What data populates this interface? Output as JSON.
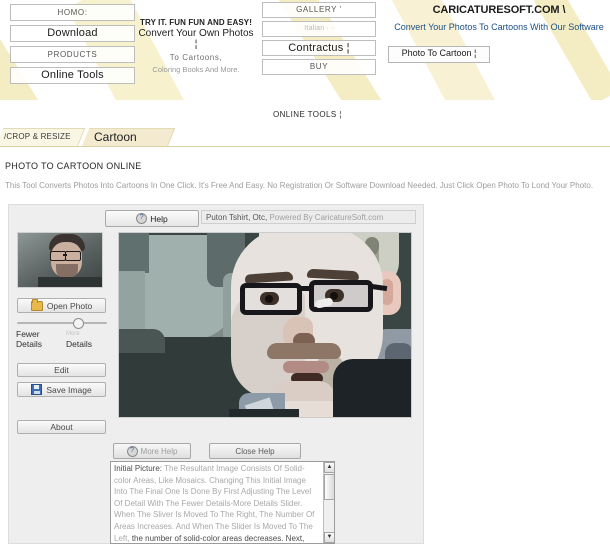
{
  "header": {
    "nav_left": [
      {
        "label": "HOMO:",
        "style": "small"
      },
      {
        "label": "Download",
        "style": "strong"
      },
      {
        "label": "PRODUCTS",
        "style": "small"
      },
      {
        "label": "Online Tools",
        "style": "strong"
      }
    ],
    "nav_right": [
      {
        "label": "GALLERY '",
        "style": "small"
      },
      {
        "label": "Italian  · ·",
        "style": "faint"
      },
      {
        "label": "Contractus ¦",
        "style": "strong"
      },
      {
        "label": "BUY",
        "style": "small"
      }
    ],
    "promo": {
      "line1": "TRY IT. FUN FUN AND EASY!",
      "line2": "Convert Your Own Photos ¦",
      "line3": "To  Cartoons,",
      "line4": "Coloring Books And More."
    },
    "brand": {
      "title": "CARICATURESOFT.COM \\",
      "subtitle": "Convert Your Photos To Cartoons With Our Software",
      "button_label": "Photo To Cartoon ¦"
    }
  },
  "section": {
    "online_tools_label": "ONLINE TOOLS ¦",
    "tabs": [
      {
        "label": "/CROP & RESIZE",
        "active": false
      },
      {
        "label": "Cartoon",
        "active": true
      }
    ],
    "page_title": "PHOTO TO CARTOON ONLINE",
    "page_description": "This Tool Converts Photos Into Cartoons In One Click. It's Free And Easy. No Registration Or Software Download Needed. Just Click Open Photo To Lond Your Photo."
  },
  "app": {
    "toolbar": {
      "help_label": "Help",
      "help_icon": "help-circle-icon",
      "puton_field_value": "Puton Tshirt, Otc,",
      "puton_field_suffix": "Powered By CaricatureSoft.com"
    },
    "controls": {
      "open_photo_label": "Open Photo",
      "open_photo_icon": "folder-open-icon",
      "edit_label": "Edit",
      "save_image_label": "Save Image",
      "save_icon": "floppy-disk-icon",
      "about_label": "About",
      "slider": {
        "left_label_line1": "Fewer",
        "left_label_line2": "Details",
        "right_label_faint": "More",
        "right_label_line2": "Details",
        "value_percent": 62
      }
    },
    "help": {
      "more_help_label": "More Help",
      "more_help_icon": "help-circle-icon",
      "close_help_label": "Close Help",
      "scroll_up_icon": "▲",
      "scroll_down_icon": "▼",
      "text_first_line": "Initial Picture:",
      "text_body": "The Resultant Image Consists Of Solid-color Areas, Like Mosaics. Changing This Initial Image Into The Final One Is Done By First Adjusting The Level Of Detail With The Fewer Details-More Details Slider. When",
      "text_body2": "The Sliver Is Moved To The Right, The Number Of Areas Increases. And When The Slider Is Moved To The Left,",
      "text_last_line": "the number of solid-color areas decreases. Next,"
    }
  },
  "colors": {
    "ribbon": "#f2e9b8",
    "tab_active": "#f3ead0",
    "brand_link": "#1b4f86",
    "muted_text": "#9d9d9d"
  }
}
